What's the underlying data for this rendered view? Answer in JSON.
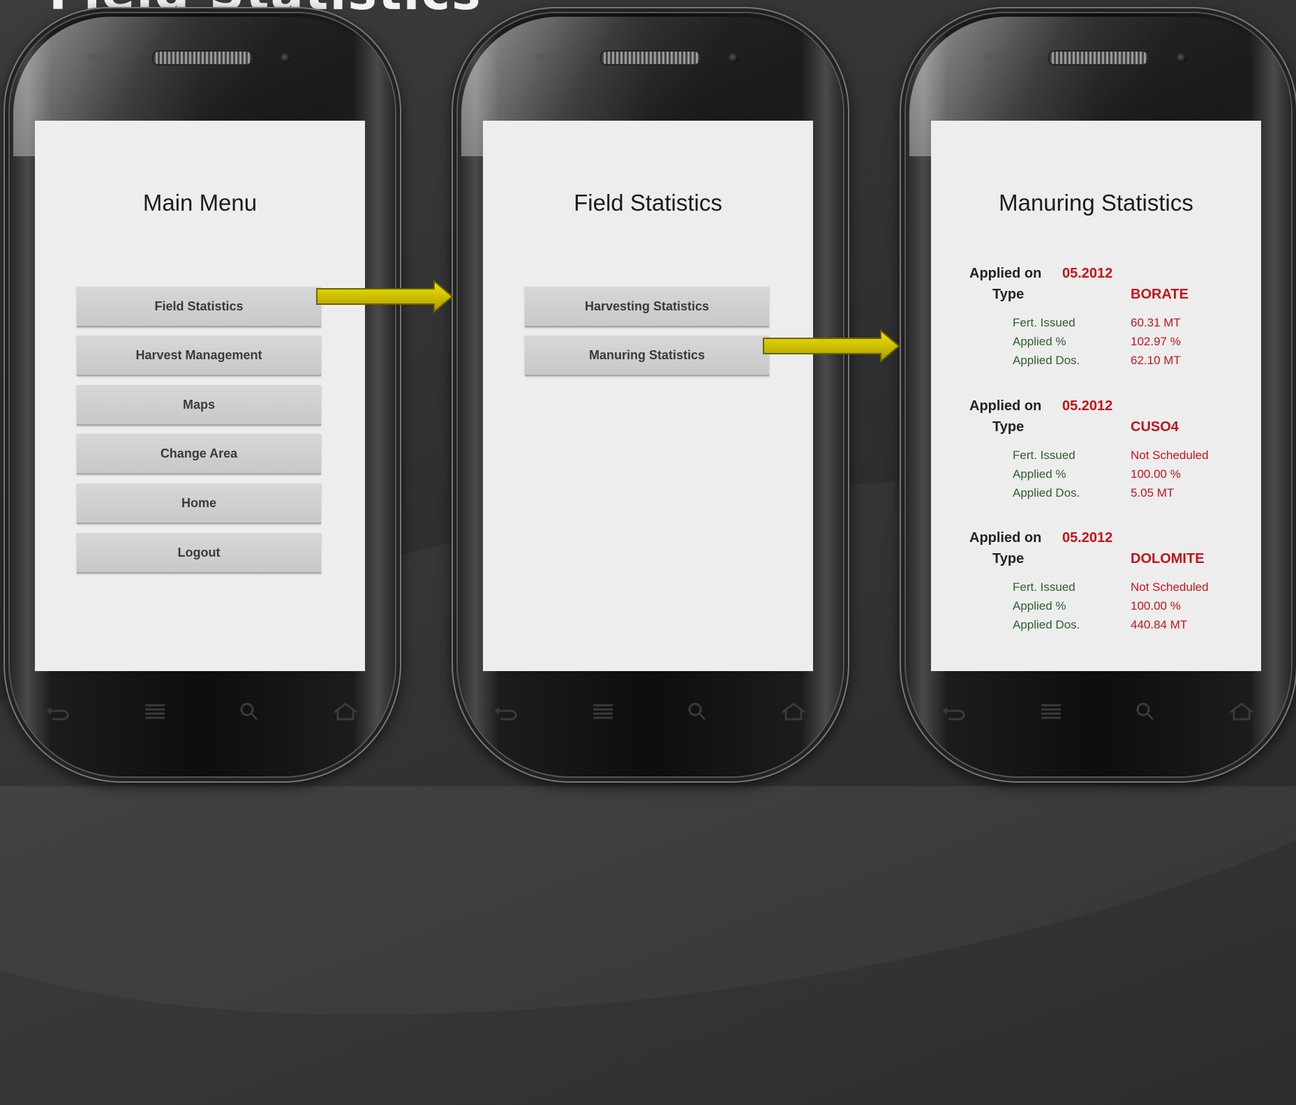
{
  "slide": {
    "title": "Field Statistics"
  },
  "screens": [
    {
      "title": "Main Menu",
      "buttons": [
        "Field Statistics",
        "Harvest Management",
        "Maps",
        "Change Area",
        "Home",
        "Logout"
      ]
    },
    {
      "title": "Field Statistics",
      "buttons": [
        "Harvesting Statistics",
        "Manuring Statistics"
      ]
    },
    {
      "title": "Manuring Statistics",
      "labels": {
        "applied_on": "Applied on",
        "type": "Type",
        "fert_issued": "Fert. Issued",
        "applied_pct": "Applied %",
        "applied_dos": "Applied Dos."
      },
      "records": [
        {
          "date": "05.2012",
          "type": "BORATE",
          "fert_issued": "60.31 MT",
          "applied_pct": "102.97 %",
          "applied_dos": "62.10 MT"
        },
        {
          "date": "05.2012",
          "type": "CUSO4",
          "fert_issued": "Not Scheduled",
          "applied_pct": "100.00 %",
          "applied_dos": "5.05 MT"
        },
        {
          "date": "05.2012",
          "type": "DOLOMITE",
          "fert_issued": "Not Scheduled",
          "applied_pct": "100.00 %",
          "applied_dos": "440.84 MT"
        }
      ]
    }
  ],
  "nav_icons": [
    "back-icon",
    "menu-icon",
    "search-icon",
    "home-icon"
  ],
  "colors": {
    "accent_red": "#c2141a",
    "arrow_yellow": "#d4c400",
    "screen_bg": "#ededed",
    "button_bg": "#cfcfcf"
  }
}
